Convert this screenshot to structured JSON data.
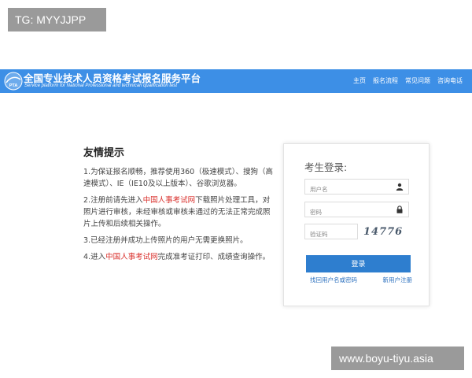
{
  "watermark_top": "TG: MYYJJPP",
  "watermark_bottom": "www.boyu-tiyu.asia",
  "header": {
    "title_cn": "全国专业技术人员资格考试报名服务平台",
    "title_en": "Service platform for National Professional and technican qualification test",
    "logo_text": "PTA",
    "nav": [
      "主页",
      "报名流程",
      "常见问题",
      "咨询电话"
    ]
  },
  "tips": {
    "heading": "友情提示",
    "item1": "1.为保证报名顺畅，推荐使用360（极速模式）、搜狗（高速模式）、IE（IE10及以上版本）、谷歌浏览器。",
    "item2_pre": "2.注册前请先进入",
    "item2_link": "中国人事考试网",
    "item2_post": "下载照片处理工具，对照片进行审核，未经审核或审核未通过的无法正常完成照片上传和后续相关操作。",
    "item3": "3.已经注册并成功上传照片的用户无需更换照片。",
    "item4_pre": "4.进入",
    "item4_link": "中国人事考试网",
    "item4_post": "完成准考证打印、成绩查询操作。"
  },
  "login": {
    "title": "考生登录:",
    "username_placeholder": "用户名",
    "password_placeholder": "密码",
    "captcha_placeholder": "验证码",
    "captcha_text": "14776",
    "submit_label": "登录",
    "forgot_link": "找回用户名或密码",
    "register_link": "新用户注册"
  },
  "icons": {
    "user": "user-icon",
    "lock": "lock-icon"
  },
  "colors": {
    "header_blue": "#3d8fe6",
    "button_blue": "#2e7ecf",
    "link_red": "#d9302c",
    "link_blue": "#2a6fbe"
  }
}
